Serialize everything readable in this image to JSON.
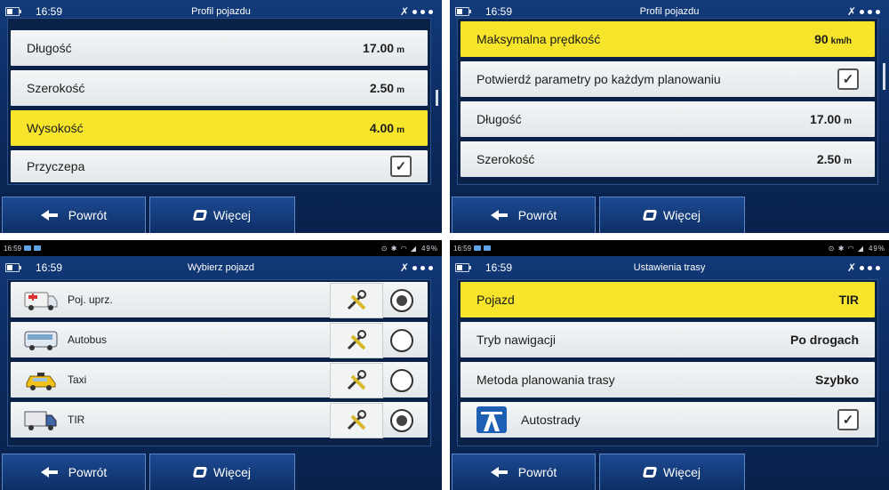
{
  "status_bar": {
    "time": "16:59",
    "battery": "49%"
  },
  "screens": {
    "top_left": {
      "time": "16:59",
      "title": "Profil pojazdu",
      "rows": [
        {
          "label": "Długość",
          "value": "17.00",
          "unit": "m"
        },
        {
          "label": "Szerokość",
          "value": "2.50",
          "unit": "m"
        },
        {
          "label": "Wysokość",
          "value": "4.00",
          "unit": "m"
        },
        {
          "label": "Przyczepa",
          "checked": "✓"
        }
      ],
      "back_label": "Powrót",
      "more_label": "Więcej"
    },
    "top_right": {
      "time": "16:59",
      "title": "Profil pojazdu",
      "rows": [
        {
          "label": "Maksymalna prędkość",
          "value": "90",
          "unit": "km/h"
        },
        {
          "label": "Potwierdź parametry po każdym planowaniu",
          "checked": "✓"
        },
        {
          "label": "Długość",
          "value": "17.00",
          "unit": "m"
        },
        {
          "label": "Szerokość",
          "value": "2.50",
          "unit": "m"
        }
      ],
      "back_label": "Powrót",
      "more_label": "Więcej"
    },
    "bottom_left": {
      "time": "16:59",
      "title": "Wybierz pojazd",
      "vehicles": [
        {
          "label": "Poj. uprz.",
          "selected": true
        },
        {
          "label": "Autobus",
          "selected": false
        },
        {
          "label": "Taxi",
          "selected": false
        },
        {
          "label": "TIR",
          "selected": true
        }
      ],
      "back_label": "Powrót",
      "more_label": "Więcej"
    },
    "bottom_right": {
      "time": "16:59",
      "title": "Ustawienia trasy",
      "rows": [
        {
          "label": "Pojazd",
          "value": "TIR"
        },
        {
          "label": "Tryb nawigacji",
          "value": "Po drogach"
        },
        {
          "label": "Metoda planowania trasy",
          "value": "Szybko"
        },
        {
          "label": "Autostrady",
          "checked": "✓"
        }
      ],
      "back_label": "Powrót",
      "more_label": "Więcej"
    }
  },
  "colors": {
    "highlight": "#f7e52b",
    "background": "#0b2a5e",
    "row": "#e9ecee"
  },
  "icons": [
    "battery-icon",
    "settings-icon",
    "back-arrow-icon",
    "more-icon",
    "ambulance-icon",
    "bus-icon",
    "taxi-icon",
    "truck-icon",
    "tools-icon",
    "highway-icon"
  ]
}
